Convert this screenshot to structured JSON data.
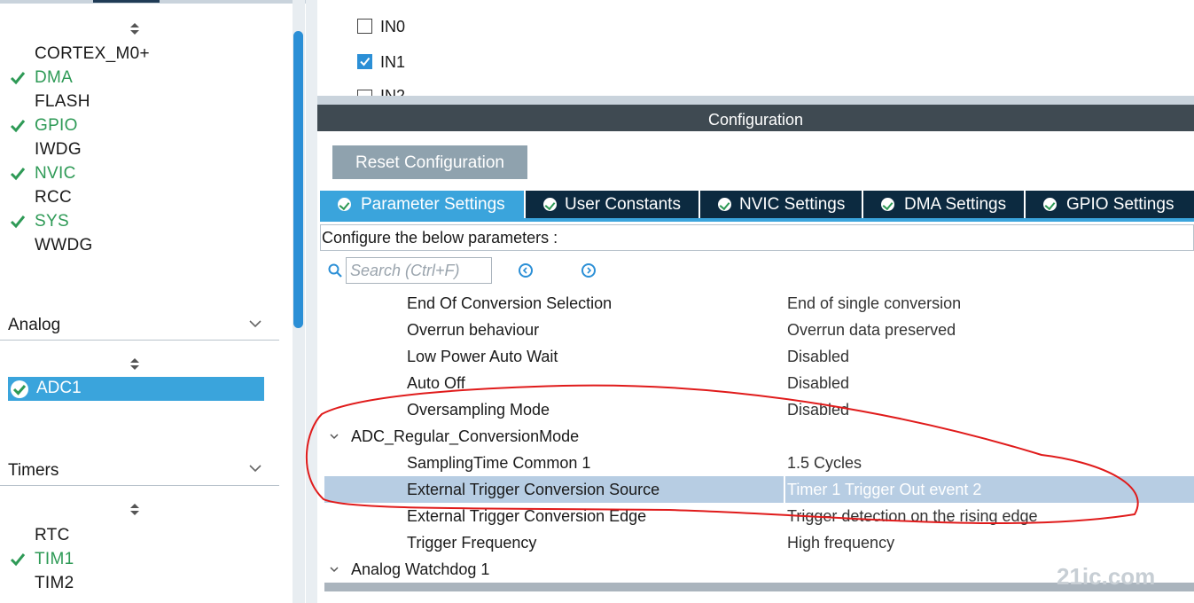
{
  "sidebar": {
    "system_items": [
      {
        "label": "CORTEX_M0+",
        "enabled": false
      },
      {
        "label": "DMA",
        "enabled": true
      },
      {
        "label": "FLASH",
        "enabled": false
      },
      {
        "label": "GPIO",
        "enabled": true
      },
      {
        "label": "IWDG",
        "enabled": false
      },
      {
        "label": "NVIC",
        "enabled": true
      },
      {
        "label": "RCC",
        "enabled": false
      },
      {
        "label": "SYS",
        "enabled": true
      },
      {
        "label": "WWDG",
        "enabled": false
      }
    ],
    "analog": {
      "title": "Analog",
      "items": [
        {
          "label": "ADC1",
          "selected": true
        }
      ]
    },
    "timers": {
      "title": "Timers",
      "items": [
        {
          "label": "RTC",
          "enabled": false
        },
        {
          "label": "TIM1",
          "enabled": true
        },
        {
          "label": "TIM2",
          "enabled": false
        }
      ]
    }
  },
  "channels": [
    {
      "label": "IN0",
      "checked": false
    },
    {
      "label": "IN1",
      "checked": true
    },
    {
      "label": "IN2",
      "checked": false
    }
  ],
  "config": {
    "header": "Configuration",
    "reset_button": "Reset Configuration",
    "tabs": [
      "Parameter Settings",
      "User Constants",
      "NVIC Settings",
      "DMA Settings",
      "GPIO Settings"
    ],
    "active_tab": "Parameter Settings",
    "hint": "Configure the below parameters :",
    "search_placeholder": "Search (Ctrl+F)"
  },
  "parameters": [
    {
      "name": "End Of Conversion Selection",
      "value": "End of single conversion"
    },
    {
      "name": "Overrun behaviour",
      "value": "Overrun data preserved"
    },
    {
      "name": "Low Power Auto Wait",
      "value": "Disabled"
    },
    {
      "name": "Auto Off",
      "value": "Disabled"
    },
    {
      "name": "Oversampling Mode",
      "value": "Disabled"
    },
    {
      "group": "ADC_Regular_ConversionMode"
    },
    {
      "name": "SamplingTime Common 1",
      "value": "1.5 Cycles"
    },
    {
      "name": "External Trigger Conversion Source",
      "value": "Timer 1 Trigger Out event 2",
      "selected": true
    },
    {
      "name": "External Trigger Conversion Edge",
      "value": "Trigger detection on the rising edge"
    },
    {
      "name": "Trigger Frequency",
      "value": "High frequency"
    },
    {
      "group": "Analog Watchdog 1"
    }
  ],
  "colors": {
    "accent": "#3aa4dc",
    "enabled_green": "#2e9a56",
    "annotation_red": "#e01b1b"
  },
  "watermark": "21ic.com"
}
